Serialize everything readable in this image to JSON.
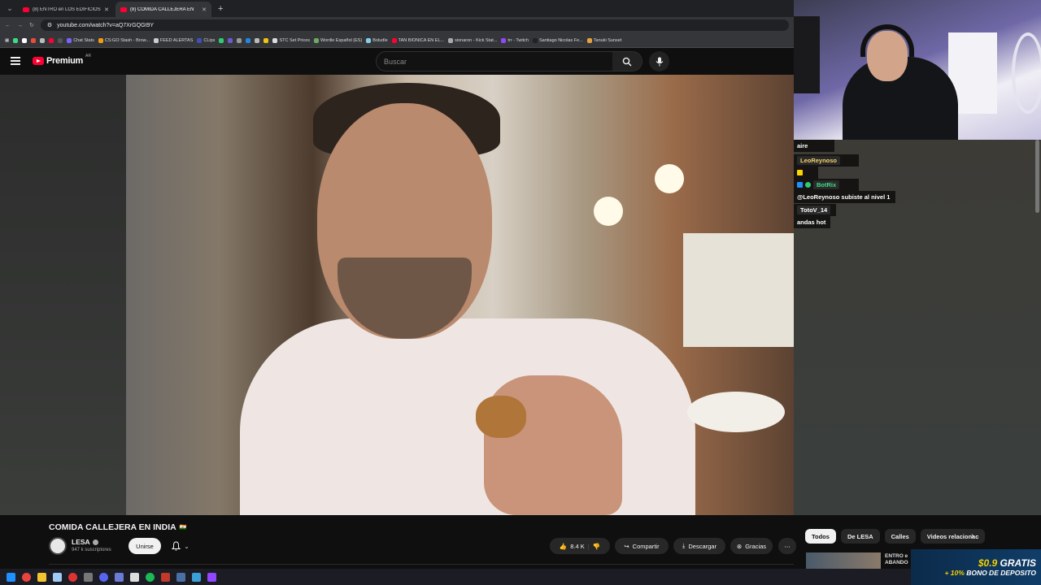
{
  "browser": {
    "tabs": [
      {
        "title": "(8) ENTRO en LOS EDIFICIOS A",
        "active": false
      },
      {
        "title": "(8) COMIDA CALLEJERA EN",
        "active": true
      }
    ],
    "url": "youtube.com/watch?v=aQ7XrGQGt9Y",
    "bookmarks": [
      "Chat Stats",
      "CS:GO Stash - Brow...",
      "FEED ALERTAS",
      "CLips",
      "STC Set Prices",
      "Wordle Español (ES)",
      "Boludle",
      "TAN BIONICA EN EL...",
      "sionaron - Kick Stat...",
      "trr - Twitch",
      "Santiago Nicolas Fe...",
      "Tanuki Sunset"
    ]
  },
  "youtube": {
    "logo_text": "Premium",
    "country": "AR",
    "search_placeholder": "Buscar"
  },
  "video": {
    "title": "COMIDA CALLEJERA EN INDIA",
    "flag": "🇮🇳"
  },
  "channel": {
    "name": "LESA",
    "subscribers": "947 k suscriptores",
    "join_label": "Unirse"
  },
  "actions": {
    "likes": "8.4 K",
    "share": "Compartir",
    "download": "Descargar",
    "thanks": "Gracias"
  },
  "chips": [
    "Todos",
    "De LESA",
    "Calles",
    "Videos relacionac"
  ],
  "related": {
    "title_line1": "ENTRO e",
    "title_line2": "ABANDO"
  },
  "chat": {
    "messages": [
      {
        "user": "",
        "text": "aire"
      },
      {
        "user": "LeoReynoso",
        "text": ""
      },
      {
        "user": "BotRix",
        "text": "@LeoReynoso subiste al nivel 1"
      },
      {
        "user": "TotoV_14",
        "text": "andas hot"
      }
    ]
  },
  "promo": {
    "line1_value": "$0.9",
    "line1_text": "GRATIS",
    "line2_value": "+ 10%",
    "line2_text": "BONO DE DEPOSITO"
  },
  "colors": {
    "youtube_red": "#ff0033",
    "background": "#0f0f0f",
    "promo_yellow": "#f5d200"
  }
}
